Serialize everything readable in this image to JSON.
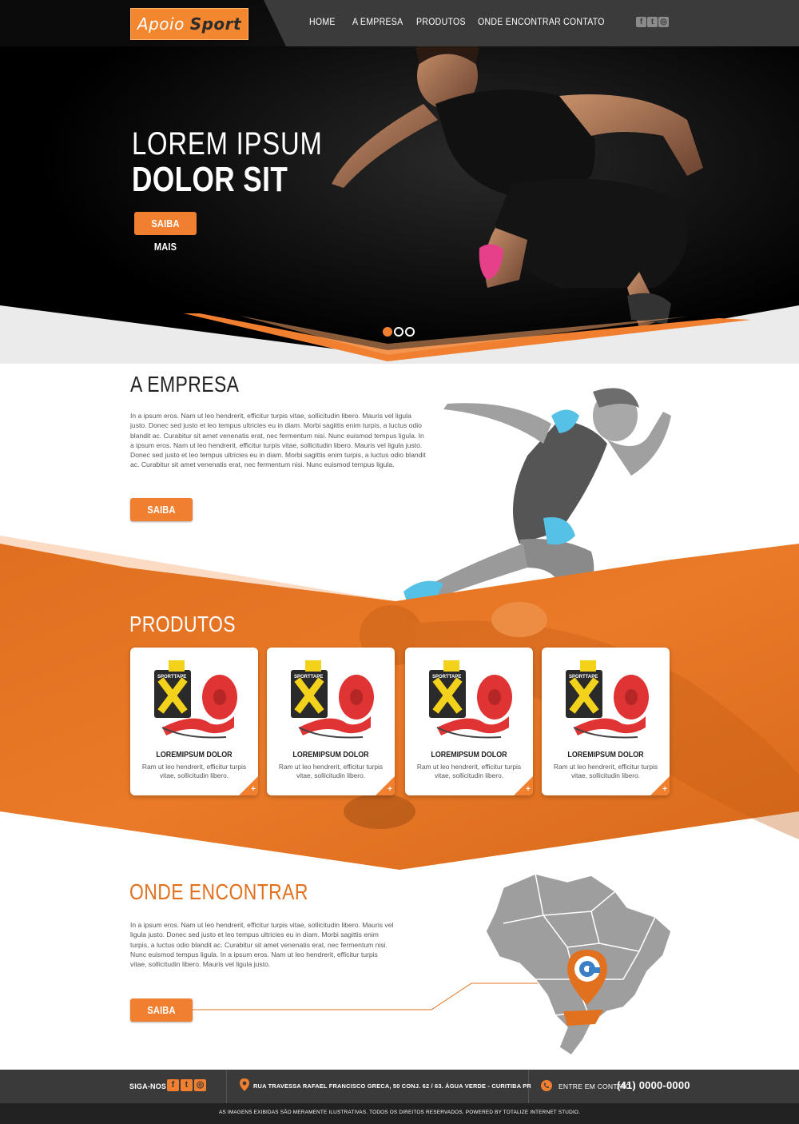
{
  "brand": {
    "logo_part1": "Apoio",
    "logo_part2": "Sport"
  },
  "nav": [
    "HOME",
    "A EMPRESA",
    "PRODUTOS",
    "ONDE ENCONTRAR",
    "CONTATO"
  ],
  "social_icons": [
    "facebook-icon",
    "twitter-icon",
    "instagram-icon"
  ],
  "hero": {
    "line1": "LOREM IPSUM",
    "line2": "DOLOR SIT",
    "button": "SAIBA MAIS",
    "slides_total": 3,
    "slide_active": 1
  },
  "empresa": {
    "title": "A EMPRESA",
    "text": "In a ipsum eros. Nam ut leo hendrerit, efficitur turpis vitae, sollicitudin libero. Mauris vel ligula justo. Donec sed justo et leo tempus ultricies eu in diam. Morbi sagittis enim turpis, a luctus odio blandit ac. Curabitur sit amet venenatis erat, nec fermentum nisi. Nunc euismod tempus ligula. In a ipsum eros. Nam ut leo hendrerit, efficitur turpis vitae, sollicitudin libero. Mauris vel ligula justo. Donec sed justo et leo tempus ultricies eu in diam. Morbi sagittis enim turpis, a luctus odio blandit ac. Curabitur sit amet venenatis erat, nec fermentum nisi. Nunc euismod tempus ligula.",
    "button": "SAIBA MAIS"
  },
  "produtos": {
    "title": "PRODUTOS",
    "items": [
      {
        "name": "LOREMIPSUM DOLOR",
        "desc": "Ram ut leo hendrerit, efficitur turpis vitae, sollicitudin libero.",
        "brand": "SPORTTAPE"
      },
      {
        "name": "LOREMIPSUM DOLOR",
        "desc": "Ram ut leo hendrerit, efficitur turpis vitae, sollicitudin libero.",
        "brand": "SPORTTAPE"
      },
      {
        "name": "LOREMIPSUM DOLOR",
        "desc": "Ram ut leo hendrerit, efficitur turpis vitae, sollicitudin libero.",
        "brand": "SPORTTAPE"
      },
      {
        "name": "LOREMIPSUM DOLOR",
        "desc": "Ram ut leo hendrerit, efficitur turpis vitae, sollicitudin libero.",
        "brand": "SPORTTAPE"
      }
    ],
    "more": "+"
  },
  "onde": {
    "title": "ONDE ENCONTRAR",
    "text": "In a ipsum eros. Nam ut leo hendrerit, efficitur turpis vitae, sollicitudin libero. Mauris vel ligula justo. Donec sed justo et leo tempus ultricies eu in diam. Morbi sagittis enim turpis, a luctus odio blandit ac. Curabitur sit amet venenatis erat, nec fermentum nisi. Nunc euismod tempus ligula. In a ipsum eros. Nam ut leo hendrerit, efficitur turpis vitae, sollicitudin libero. Mauris vel ligula justo.",
    "button": "SAIBA MAIS"
  },
  "footer": {
    "follow": "SIGA-NOS",
    "address": "RUA TRAVESSA RAFAEL FRANCISCO GRECA, 50 CONJ. 62 / 63. ÁGUA VERDE - CURITIBA PR",
    "contact_label": "ENTRE EM CONTATO -",
    "phone": "(41) 0000-0000",
    "copyright": "AS IMAGENS EXIBIDAS SÃO MERAMENTE ILUSTRATIVAS. TODOS OS DIREITOS RESERVADOS. POWERED BY TOTALIZE INTERNET STUDIO."
  },
  "colors": {
    "accent": "#f07f30",
    "dark": "#3a3a3a",
    "hero_bg": "#050505",
    "light_bg": "#ebebeb"
  }
}
